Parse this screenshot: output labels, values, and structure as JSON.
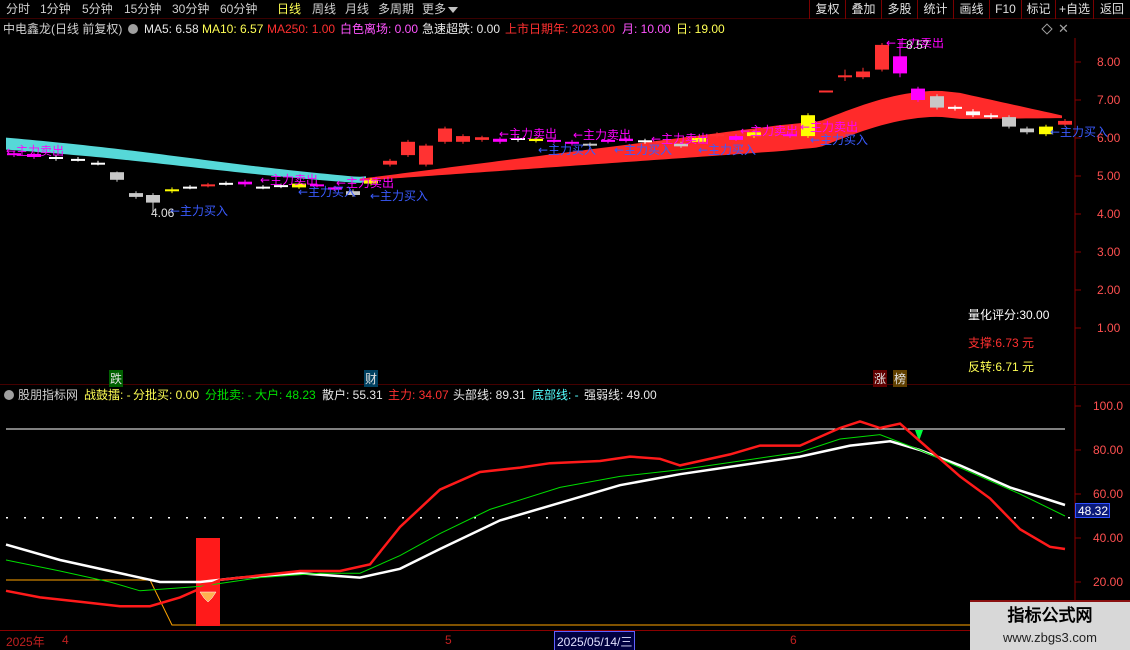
{
  "toolbar": {
    "periods": [
      "分时",
      "1分钟",
      "5分钟",
      "15分钟",
      "30分钟",
      "60分钟",
      "日线",
      "周线",
      "月线",
      "多周期",
      "更多"
    ],
    "active_period": "日线",
    "right_buttons": [
      "复权",
      "叠加",
      "多股",
      "统计",
      "画线",
      "F10",
      "标记",
      "+自选",
      "返回"
    ]
  },
  "main_panel": {
    "title": "中电鑫龙(日线 前复权)",
    "ma5": "MA5: 6.58",
    "ma10": "MA10: 6.57",
    "ma250": "MA250: 1.00",
    "white_zone": "白色离场: 0.00",
    "rapid_drop": "急速超跌: 0.00",
    "listing_year": "上市日期年: 2023.00",
    "month": "月: 10.00",
    "day": "日: 19.00",
    "y_ticks": [
      "8.00",
      "7.00",
      "6.00",
      "5.00",
      "4.00",
      "3.00",
      "2.00",
      "1.00"
    ],
    "high_label": "8.57",
    "low_label": "4.06",
    "quant_score": "量化评分:30.00",
    "support": "支撑:6.73 元",
    "reversal": "反转:6.71 元",
    "bottom_marks": [
      "跌",
      "财",
      "涨",
      "榜"
    ],
    "annotations": {
      "sell": "←主力卖出",
      "buy": "←主力买入"
    }
  },
  "sub_panel": {
    "title": "股朋指标网",
    "battle_drum": "战鼓擂: -",
    "batch_buy": "分批买: 0.00",
    "batch_sell": "分批卖: -",
    "big_holder": "大户: 48.23",
    "retail": "散户: 55.31",
    "main_force": "主力: 34.07",
    "top_line": "头部线: 89.31",
    "bottom_line": "底部线: -",
    "strength_line": "强弱线: 49.00",
    "y_ticks": [
      "100.0",
      "80.00",
      "60.00",
      "40.00",
      "20.00"
    ],
    "current_value": "48.32"
  },
  "date_axis": {
    "year_label": "2025年",
    "month_4": "4",
    "month_5": "5",
    "cursor_date": "2025/05/14/三",
    "month_6": "6"
  },
  "watermark": {
    "title": "指标公式网",
    "url": "www.zbgs3.com"
  },
  "colors": {
    "up": "#ff3232",
    "down": "#54ffff",
    "ma_white": "#ffffff",
    "magenta": "#ff00ff",
    "yellow": "#ffff00",
    "green": "#00e000",
    "label_blue": "#3a5bff",
    "grid_red": "#8a0000"
  }
}
